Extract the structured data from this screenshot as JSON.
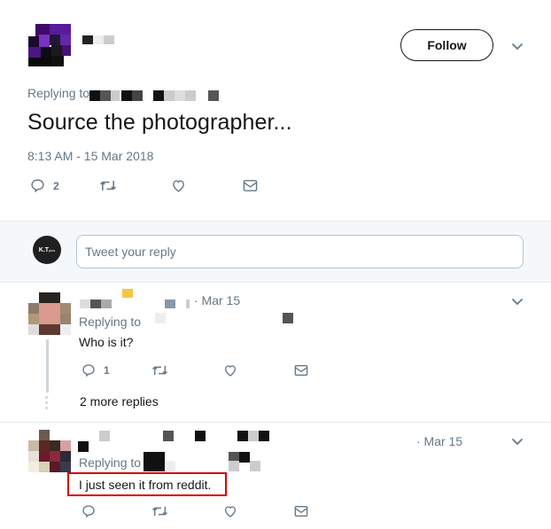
{
  "main_tweet": {
    "follow_label": "Follow",
    "replying_to_label": "Replying to",
    "text": "Source the photographer...",
    "timestamp": "8:13 AM - 15 Mar 2018",
    "actions": {
      "reply_count": "2",
      "retweet_count": "",
      "like_count": ""
    }
  },
  "composer": {
    "avatar_text": "K.T",
    "avatar_subtext": "pics",
    "placeholder": "Tweet your reply"
  },
  "replies": [
    {
      "date": "· Mar 15",
      "replying_to_label": "Replying to",
      "text": "Who is it?",
      "reply_count": "1",
      "more_replies": "2 more replies"
    },
    {
      "date": "· Mar 15",
      "replying_to_label": "Replying to",
      "text": "I just seen it from reddit.",
      "reply_count": ""
    }
  ],
  "colors": {
    "accent": "#1da1f2",
    "secondary_text": "#657786",
    "highlight": "#d40000"
  },
  "icons": [
    "chevron-down-icon",
    "reply-icon",
    "retweet-icon",
    "like-icon",
    "dm-icon"
  ]
}
